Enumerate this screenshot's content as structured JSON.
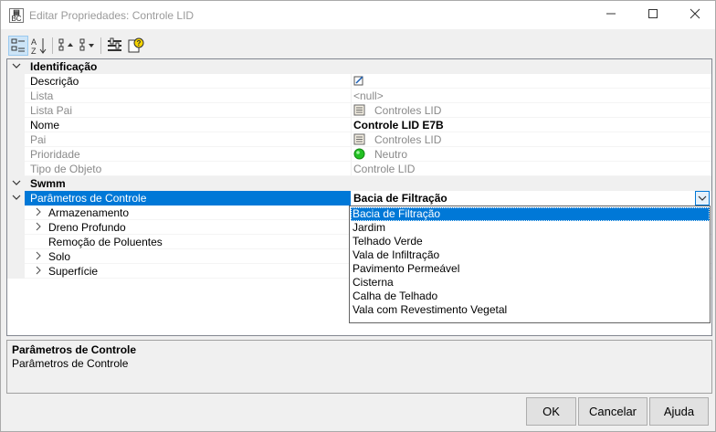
{
  "window": {
    "title": "Editar Propriedades: Controle LID",
    "app_icon_text": "BC"
  },
  "categories": {
    "identificacao": "Identificação",
    "swmm": "Swmm"
  },
  "identificacao_rows": [
    {
      "label": "Descrição",
      "value": ""
    },
    {
      "label": "Lista",
      "value": "<null>"
    },
    {
      "label": "Lista Pai",
      "value": "Controles LID"
    },
    {
      "label": "Nome",
      "value": "Controle LID E7B"
    },
    {
      "label": "Pai",
      "value": "Controles LID"
    },
    {
      "label": "Prioridade",
      "value": "Neutro"
    },
    {
      "label": "Tipo de Objeto",
      "value": "Controle LID"
    }
  ],
  "swmm_rows": {
    "parametros": {
      "label": "Parâmetros de Controle",
      "value": "Bacia de Filtração"
    },
    "children": [
      "Armazenamento",
      "Dreno Profundo",
      "Remoção de Poluentes",
      "Solo",
      "Superfície"
    ]
  },
  "dropdown_options": [
    "Bacia de Filtração",
    "Jardim",
    "Telhado Verde",
    "Vala de Infiltração",
    "Pavimento Permeável",
    "Cisterna",
    "Calha de Telhado",
    "Vala com Revestimento Vegetal"
  ],
  "selected_option_index": 0,
  "description": {
    "title": "Parâmetros de Controle",
    "body": "Parâmetros de Controle"
  },
  "buttons": {
    "ok": "OK",
    "cancel": "Cancelar",
    "help": "Ajuda"
  },
  "colors": {
    "selection": "#0078d7",
    "priority_dot": "#22c022"
  }
}
